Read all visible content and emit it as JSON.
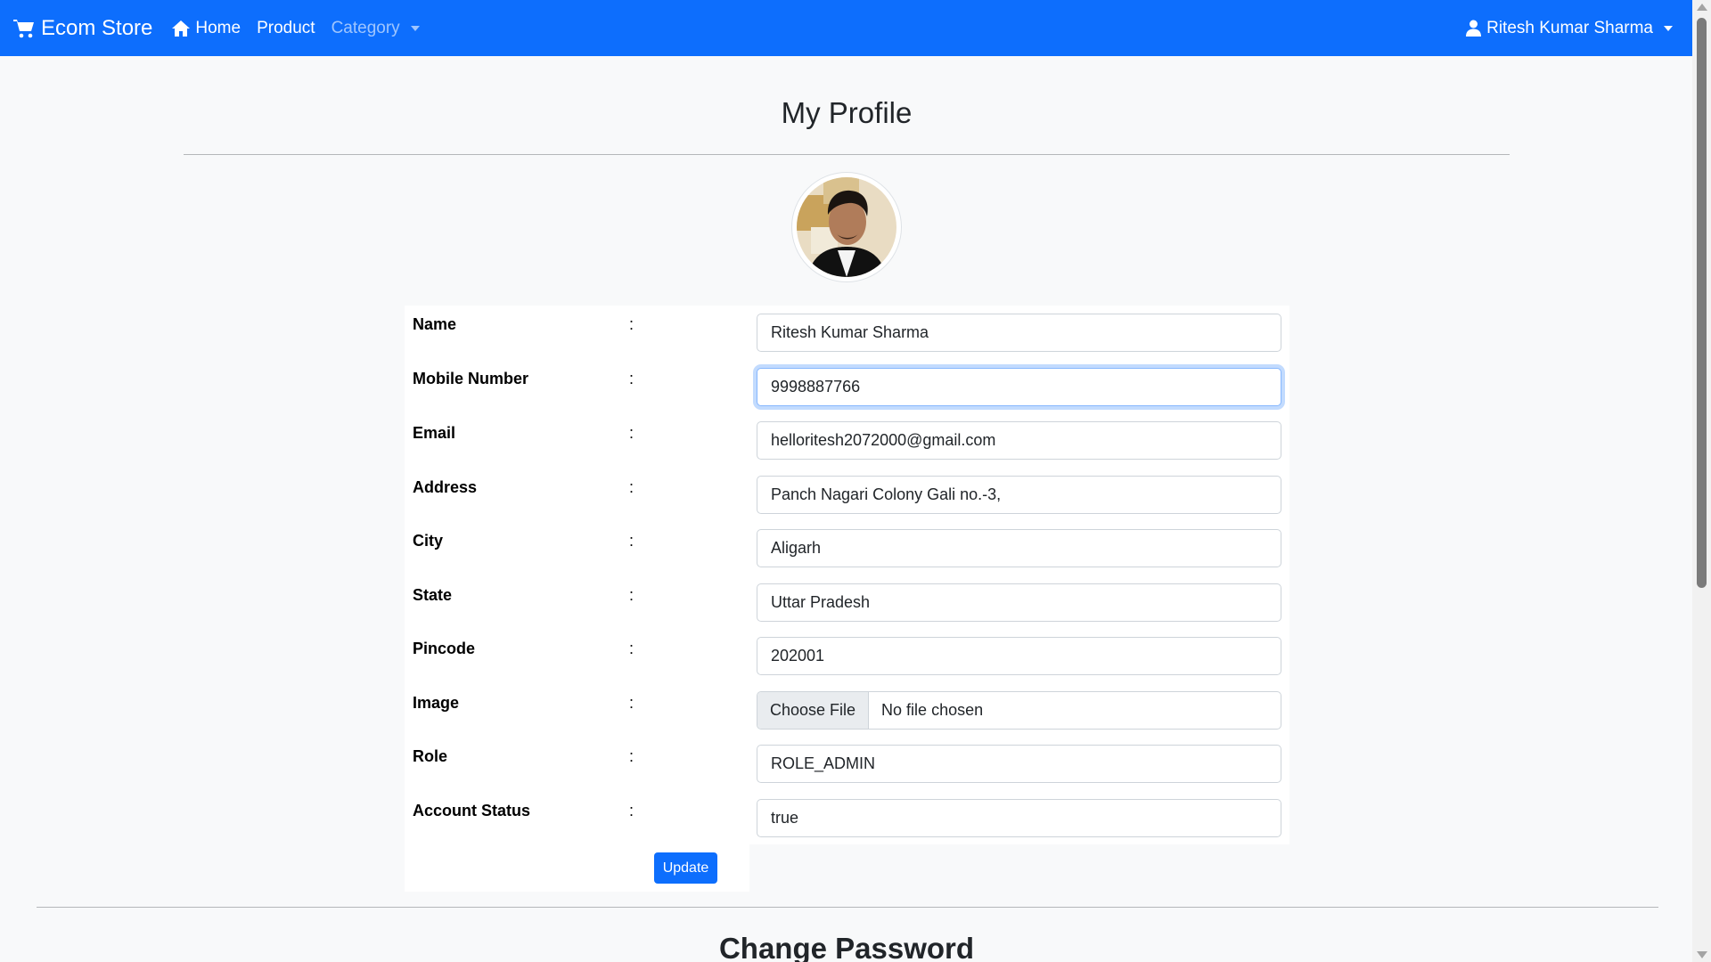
{
  "navbar": {
    "brand": "Ecom Store",
    "home": "Home",
    "product": "Product",
    "category": "Category",
    "user": "Ritesh Kumar Sharma",
    "color": "#0d6efd"
  },
  "page": {
    "title": "My Profile",
    "avatar_alt": "profile photo"
  },
  "form": {
    "colon": ":",
    "rows": [
      {
        "label": "Name",
        "value": "Ritesh Kumar Sharma"
      },
      {
        "label": "Mobile Number",
        "value": "9998887766"
      },
      {
        "label": "Email",
        "value": "helloritesh2072000@gmail.com"
      },
      {
        "label": "Address",
        "value": "Panch Nagari Colony Gali no.-3,"
      },
      {
        "label": "City",
        "value": "Aligarh"
      },
      {
        "label": "State",
        "value": "Uttar Pradesh"
      },
      {
        "label": "Pincode",
        "value": "202001"
      },
      {
        "label": "Image",
        "file_button": "Choose File",
        "file_status": "No file chosen"
      },
      {
        "label": "Role",
        "value": "ROLE_ADMIN"
      },
      {
        "label": "Account Status",
        "value": "true"
      }
    ],
    "update_label": "Update"
  },
  "change_password": {
    "title": "Change Password"
  }
}
